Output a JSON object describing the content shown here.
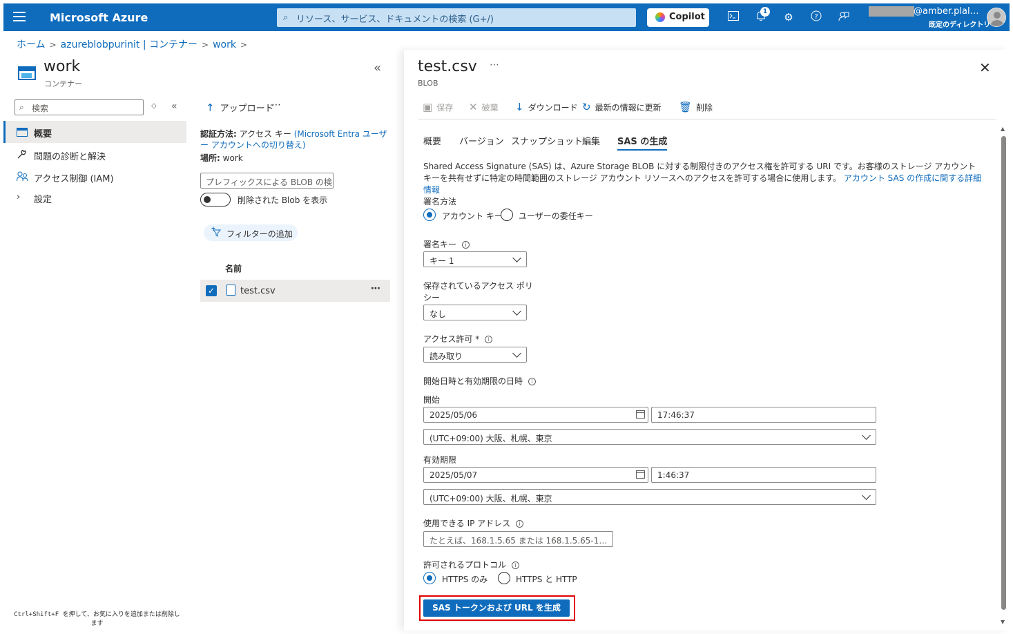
{
  "topbar": {
    "brand": "Microsoft Azure",
    "search_placeholder": "リソース、サービス、ドキュメントの検索 (G+/)",
    "copilot_label": "Copilot",
    "notification_count": "1",
    "account_name": "@amber.plal…",
    "directory": "既定のディレクトリ",
    "icons": [
      "cloud-shell-icon",
      "bell-icon",
      "gear-icon",
      "help-icon",
      "feedback-icon"
    ]
  },
  "breadcrumb": {
    "items": [
      "ホーム",
      "azureblobpurinit | コンテナー",
      "work"
    ]
  },
  "blade": {
    "title": "work",
    "subtitle": "コンテナー",
    "search_placeholder": "検索",
    "nav": [
      {
        "label": "概要",
        "icon": "overview-icon",
        "selected": true
      },
      {
        "label": "問題の診断と解決",
        "icon": "wrench-icon",
        "selected": false
      },
      {
        "label": "アクセス制御 (IAM)",
        "icon": "people-icon",
        "selected": false
      },
      {
        "label": "設定",
        "icon": "chevron-right-icon",
        "selected": false
      }
    ],
    "footer_hint": "Ctrl+Shift+F を押して、お気に入りを追加または削除します"
  },
  "middle": {
    "upload_label": "アップロード",
    "auth_label": "認証方法:",
    "auth_value": "アクセス キー",
    "auth_link": "(Microsoft Entra ユーザー アカウントへの切り替え)",
    "location_label": "場所:",
    "location_value": "work",
    "prefix_placeholder": "プレフィックスによる BLOB の検…",
    "show_deleted_label": "削除された Blob を表示",
    "add_filter_label": "フィルターの追加",
    "column_name": "名前",
    "files": [
      {
        "name": "test.csv",
        "checked": true
      }
    ]
  },
  "panel": {
    "title": "test.csv",
    "subtitle": "BLOB",
    "toolbar": {
      "save": "保存",
      "discard": "破棄",
      "download": "ダウンロード",
      "refresh": "最新の情報に更新",
      "delete": "削除"
    },
    "tabs": [
      "概要",
      "バージョン",
      "スナップショット",
      "編集",
      "SAS の生成"
    ],
    "selected_tab": "SAS の生成",
    "description": "Shared Access Signature (SAS) は、Azure Storage BLOB に対する制限付きのアクセス権を許可する URI です。お客様のストレージ アカウント キーを共有せずに特定の時間範囲のストレージ アカウント リソースへのアクセスを許可する場合に使用します。",
    "description_link": "アカウント SAS の作成に関する詳細情報",
    "signing_method_label": "署名方法",
    "signing_method_options": [
      "アカウント キー",
      "ユーザーの委任キー"
    ],
    "signing_method_selected": "アカウント キー",
    "signing_key_label": "署名キー",
    "signing_key_value": "キー 1",
    "stored_policy_label_line1": "保存されているアクセス ポリ",
    "stored_policy_label_line2": "シー",
    "stored_policy_value": "なし",
    "permissions_label": "アクセス許可 *",
    "permissions_value": "読み取り",
    "start_expiry_label": "開始日時と有効期限の日時",
    "start_label": "開始",
    "start_date": "2025/05/06",
    "start_time": "17:46:37",
    "start_timezone": "(UTC+09:00) 大阪、札幌、東京",
    "expiry_label": "有効期限",
    "expiry_date": "2025/05/07",
    "expiry_time": "1:46:37",
    "expiry_timezone": "(UTC+09:00) 大阪、札幌、東京",
    "ip_label": "使用できる IP アドレス",
    "ip_placeholder": "たとえば、168.1.5.65 または 168.1.5.65-1…",
    "protocol_label": "許可されるプロトコル",
    "protocol_options": [
      "HTTPS のみ",
      "HTTPS と HTTP"
    ],
    "protocol_selected": "HTTPS のみ",
    "generate_button": "SAS トークンおよび URL を生成"
  },
  "colors": {
    "brand_blue": "#0f6cbd",
    "highlight_red": "#e00000"
  }
}
